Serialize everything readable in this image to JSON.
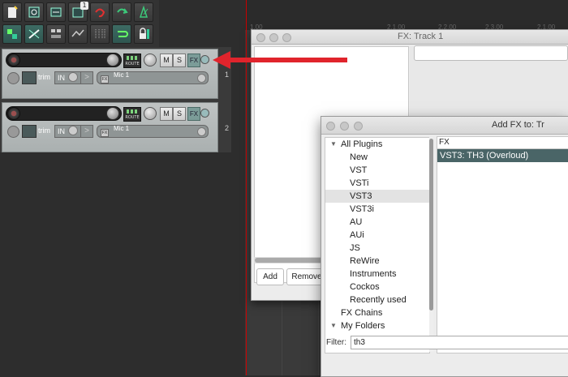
{
  "toolbar": {
    "icons": [
      "new-project-icon",
      "save-project-icon",
      "undo-history-icon",
      "project-settings-icon",
      "undo-icon",
      "redo-icon",
      "metronome-icon",
      "grid-snap-icon",
      "ripple-edit-icon",
      "item-grouping-icon",
      "envelope-points-icon",
      "vertical-zoom-icon",
      "loop-icon",
      "lock-icon"
    ],
    "badge": "1"
  },
  "tracks": [
    {
      "number": "1",
      "input_label": "Mic 1",
      "trim_label": "trim",
      "in_label": "IN",
      "route_label": "ROUTE",
      "mute_label": "M",
      "solo_label": "S",
      "fx_label": "FX",
      "fx_mini": "FX"
    },
    {
      "number": "2",
      "input_label": "Mic 1",
      "trim_label": "trim",
      "in_label": "IN",
      "route_label": "ROUTE",
      "mute_label": "M",
      "solo_label": "S",
      "fx_label": "FX",
      "fx_mini": "FX"
    }
  ],
  "ruler": {
    "labels": [
      "1.00",
      "2.1.00",
      "2.2.00",
      "2.3.00",
      "2.1.00"
    ]
  },
  "fx_window": {
    "title": "FX: Track 1",
    "add_button": "Add",
    "remove_button": "Remove"
  },
  "add_fx": {
    "title": "Add FX to: Tr",
    "search_value": "FX",
    "folders": [
      {
        "label": "All Plugins",
        "expanded": true,
        "level": 0
      },
      {
        "label": "New",
        "level": 1
      },
      {
        "label": "VST",
        "level": 1
      },
      {
        "label": "VSTi",
        "level": 1
      },
      {
        "label": "VST3",
        "level": 1,
        "selected": true
      },
      {
        "label": "VST3i",
        "level": 1
      },
      {
        "label": "AU",
        "level": 1
      },
      {
        "label": "AUi",
        "level": 1
      },
      {
        "label": "JS",
        "level": 1
      },
      {
        "label": "ReWire",
        "level": 1
      },
      {
        "label": "Instruments",
        "level": 1
      },
      {
        "label": "Cockos",
        "level": 1
      },
      {
        "label": "Recently used",
        "level": 1
      },
      {
        "label": "FX Chains",
        "level": 0
      },
      {
        "label": "My Folders",
        "expanded": true,
        "level": 0
      }
    ],
    "plugins": [
      "VST3: TH3 (Overloud)"
    ],
    "filter_label": "Filter:",
    "filter_value": "th3"
  },
  "colors": {
    "accent": "#4a6567",
    "arrow": "#e0242c",
    "cursor": "#cc0000"
  }
}
